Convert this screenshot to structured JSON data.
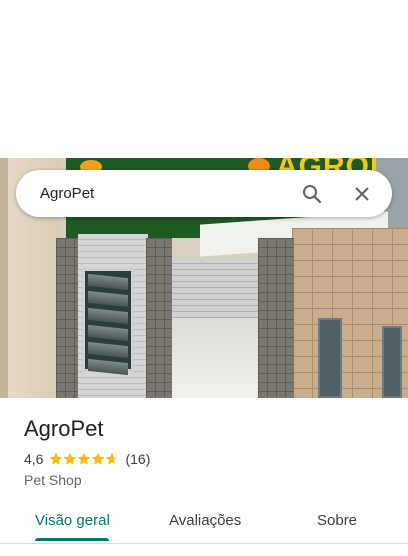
{
  "search": {
    "query": "AgroPet"
  },
  "icons": {
    "search": "search-icon",
    "close": "close-icon",
    "star": "star-icon"
  },
  "photo": {
    "sign_text": "AGROPET"
  },
  "place": {
    "name": "AgroPet",
    "rating": "4,6",
    "rating_value": 4.6,
    "review_count": "(16)",
    "category": "Pet Shop"
  },
  "tabs": [
    {
      "label": "Visão geral",
      "active": true
    },
    {
      "label": "Avaliações",
      "active": false
    },
    {
      "label": "Sobre",
      "active": false
    }
  ],
  "colors": {
    "accent": "#00796b",
    "star": "#fbbc04",
    "star_empty": "#dadce0"
  }
}
